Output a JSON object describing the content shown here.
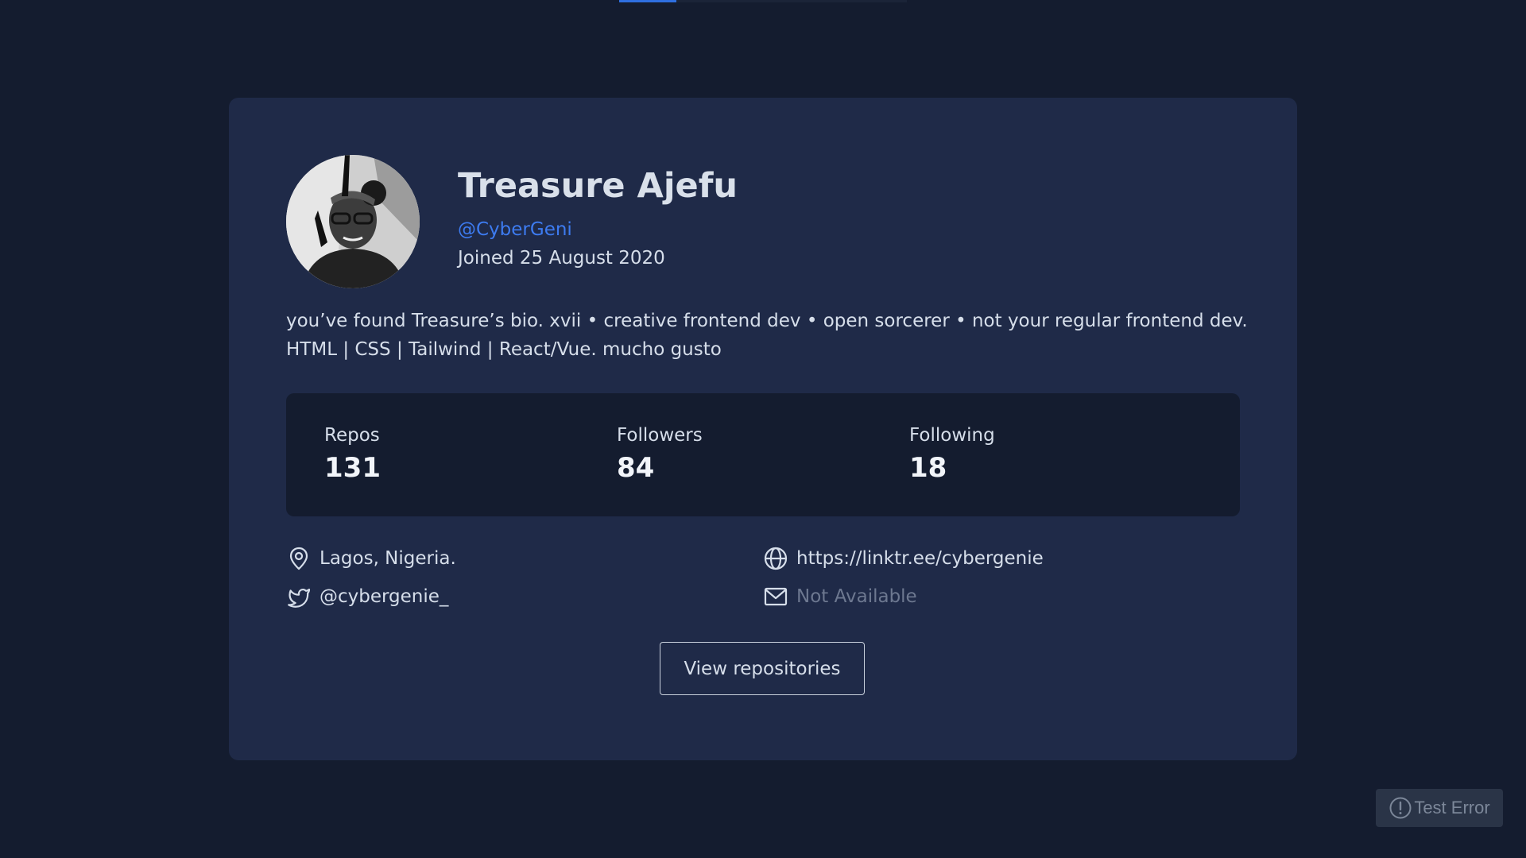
{
  "profile": {
    "name": "Treasure Ajefu",
    "handle": "@CyberGeni",
    "joined": "Joined 25 August 2020",
    "bio": "you’ve found Treasure’s bio. xvii • creative frontend dev • open sorcerer • not your regular frontend dev. HTML | CSS | Tailwind | React/Vue. mucho gusto"
  },
  "stats": {
    "repos": {
      "label": "Repos",
      "value": "131"
    },
    "followers": {
      "label": "Followers",
      "value": "84"
    },
    "following": {
      "label": "Following",
      "value": "18"
    }
  },
  "links": {
    "location": {
      "icon": "location-pin-icon",
      "text": "Lagos, Nigeria."
    },
    "website": {
      "icon": "globe-icon",
      "text": "https://linktr.ee/cybergenie"
    },
    "twitter": {
      "icon": "twitter-icon",
      "text": "@cybergenie_"
    },
    "email": {
      "icon": "mail-icon",
      "text": "Not Available"
    }
  },
  "actions": {
    "view_repositories": "View repositories"
  },
  "toast": {
    "icon": "alert-circle-icon",
    "label": "Test Error"
  },
  "colors": {
    "background": "#141c2f",
    "card": "#1f2a48",
    "accent": "#3d7bf0",
    "muted": "#6d7890"
  }
}
